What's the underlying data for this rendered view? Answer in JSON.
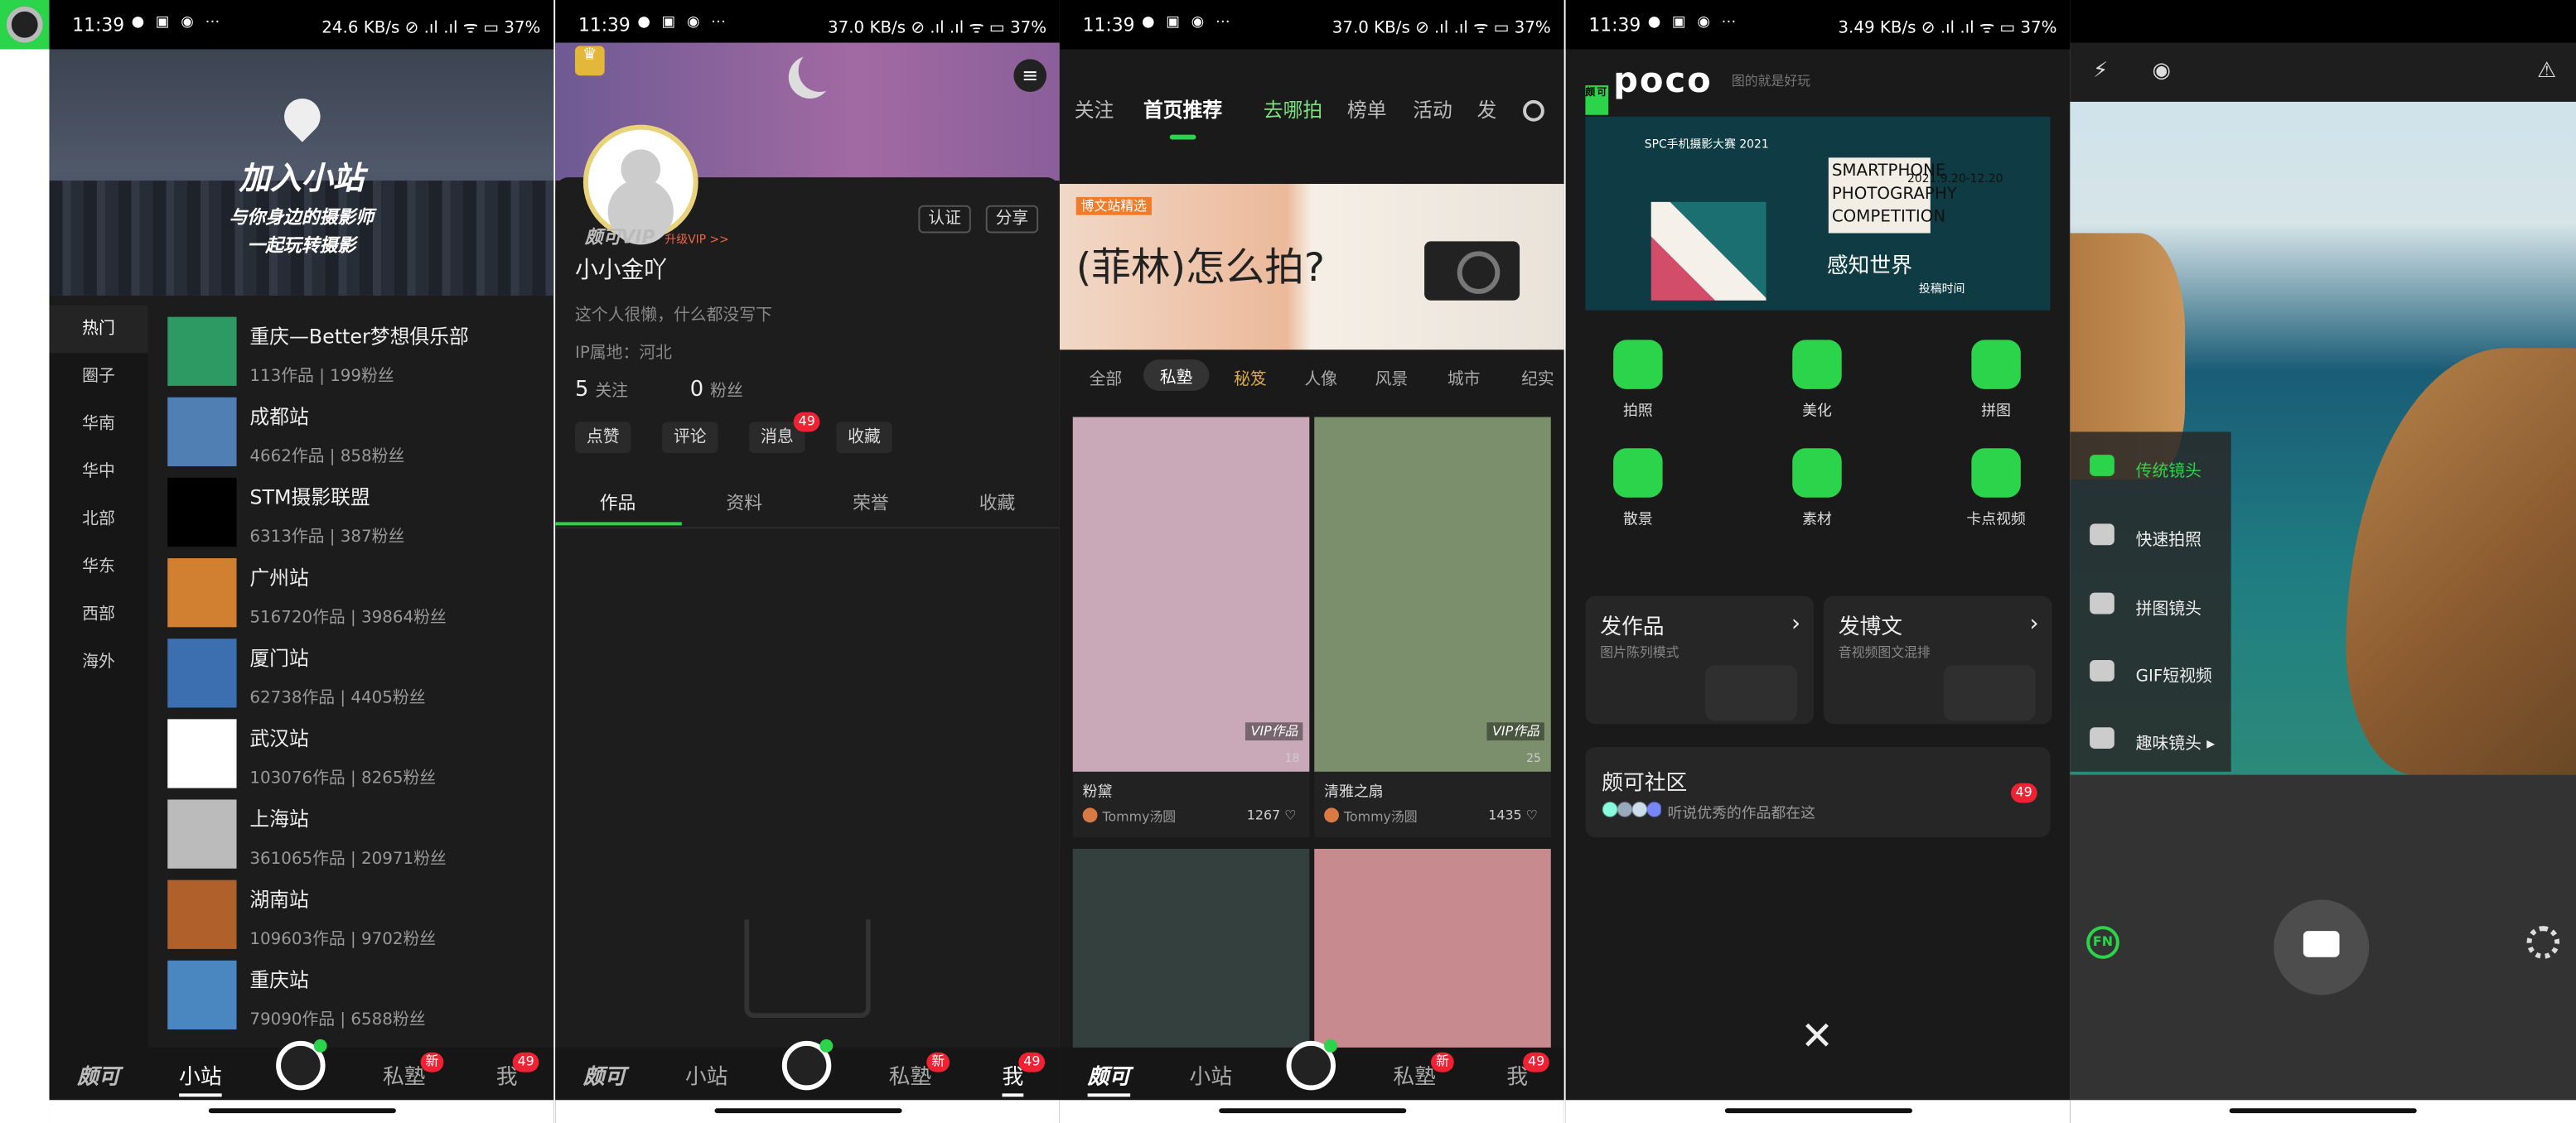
{
  "status_bar": {
    "time": "11:39",
    "icons": "● ▣ ◉ ⋯",
    "panels_right": [
      "24.6 KB/s ⊘ .ıl .ıl ᯤ ▭ 37%",
      "37.0 KB/s ⊘ .ıl .ıl ᯤ ▭ 37%",
      "37.0 KB/s ⊘ .ıl .ıl ᯤ ▭ 37%",
      "3.49 KB/s ⊘ .ıl .ıl ᯤ ▭ 37%"
    ]
  },
  "tabbar": {
    "logo": "颇可",
    "stations": "小站",
    "private": "私塾",
    "private_badge": "新",
    "me": "我",
    "me_badge": "49"
  },
  "stations": {
    "hero_title": "加入小站",
    "hero_line1": "与你身边的摄影师",
    "hero_line2": "一起玩转摄影",
    "regions": [
      "热门",
      "圈子",
      "华南",
      "华中",
      "北部",
      "华东",
      "西部",
      "海外"
    ],
    "items": [
      {
        "name": "重庆—Better梦想俱乐部",
        "stats": "113作品 | 199粉丝",
        "color": "#2e9a63"
      },
      {
        "name": "成都站",
        "stats": "4662作品 | 858粉丝",
        "color": "#4f7fb3"
      },
      {
        "name": "STM摄影联盟",
        "stats": "6313作品 | 387粉丝",
        "color": "#000000"
      },
      {
        "name": "广州站",
        "stats": "516720作品 | 39864粉丝",
        "color": "#d08030"
      },
      {
        "name": "厦门站",
        "stats": "62738作品 | 4405粉丝",
        "color": "#3c6fb0"
      },
      {
        "name": "武汉站",
        "stats": "103076作品 | 8265粉丝",
        "color": "#ffffff"
      },
      {
        "name": "上海站",
        "stats": "361065作品 | 20971粉丝",
        "color": "#bbbbbb"
      },
      {
        "name": "湖南站",
        "stats": "109603作品 | 9702粉丝",
        "color": "#b0602a"
      },
      {
        "name": "重庆站",
        "stats": "79090作品 | 6588粉丝",
        "color": "#4a86c0"
      }
    ]
  },
  "profile": {
    "vip_label": "颇可VIP",
    "upgrade": "升级VIP >>",
    "certify": "认证",
    "share": "分享",
    "name": "小小金吖",
    "bio": "这个人很懒，什么都没写下",
    "ip": "IP属地：河北",
    "follow_count": "5",
    "follow_label": "关注",
    "fans_count": "0",
    "fans_label": "粉丝",
    "chips": [
      "点赞",
      "评论",
      "消息",
      "收藏"
    ],
    "msg_badge": "49",
    "tabs": [
      "作品",
      "资料",
      "荣誉",
      "收藏"
    ]
  },
  "feed": {
    "nav": [
      "关注",
      "首页推荐",
      "去哪拍",
      "榜单",
      "活动",
      "发"
    ],
    "banner_tag": "博文站精选",
    "banner_title": "(菲林)怎么拍?",
    "categories": [
      "全部",
      "私塾",
      "秘笈",
      "人像",
      "风景",
      "城市",
      "纪实"
    ],
    "cards": [
      {
        "caption": "粉黛",
        "author": "Tommy汤圆",
        "likes": "1267",
        "count": "18",
        "vip": "VIP作品",
        "bg": "#c9a9b8"
      },
      {
        "caption": "清雅之扇",
        "author": "Tommy汤圆",
        "likes": "1435",
        "count": "25",
        "vip": "VIP作品",
        "bg": "#7c8f6c"
      },
      {
        "caption": "",
        "author": "",
        "likes": "",
        "count": "",
        "vip": "",
        "bg": "#33403e"
      },
      {
        "caption": "",
        "author": "",
        "likes": "",
        "count": "",
        "vip": "",
        "bg": "#c78b8f"
      }
    ]
  },
  "poco": {
    "logo": "poco",
    "slogan": "图的就是好玩",
    "banner": {
      "l1": "SPC手机摄影大赛 2021",
      "l2": "SMARTPHONE PHOTOGRAPHY COMPETITION",
      "l3": "感知世界",
      "l4": "2021.9.20-12.20",
      "l5": "投稿时间"
    },
    "tools": [
      "拍照",
      "美化",
      "拼图",
      "散景",
      "素材",
      "卡点视频"
    ],
    "post_title": "发作品",
    "post_sub": "图片陈列模式",
    "blog_title": "发博文",
    "blog_sub": "音视频图文混排",
    "community": "颇可社区",
    "community_sub": "听说优秀的作品都在这",
    "community_badge": "49",
    "close": "✕"
  },
  "camera": {
    "menu": [
      "传统镜头",
      "快速拍照",
      "拼图镜头",
      "GIF短视频",
      "趣味镜头 ▸"
    ],
    "fn": "FN",
    "top_icons": [
      "⚡",
      "◉",
      "⚠"
    ]
  }
}
